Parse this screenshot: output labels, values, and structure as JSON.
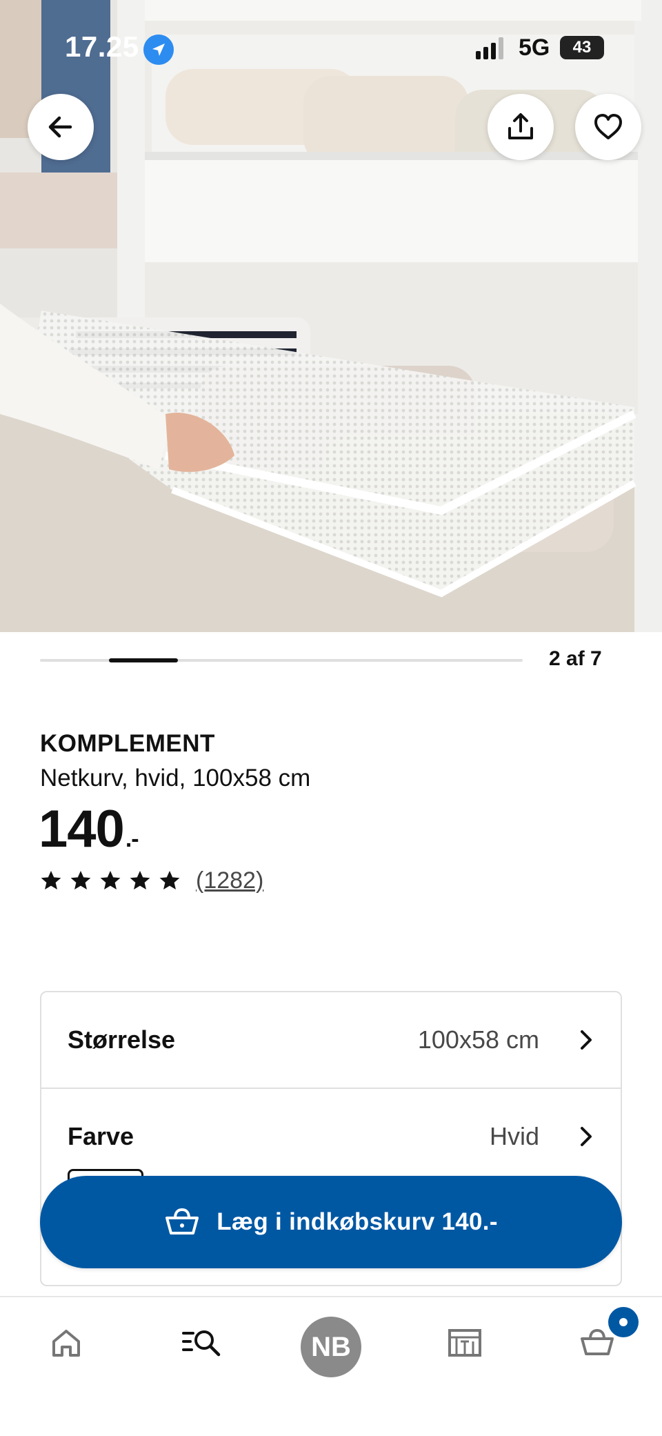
{
  "status_bar": {
    "time": "17.25",
    "network": "5G",
    "battery": "43"
  },
  "hero": {
    "icons": [
      "arrow-left-icon",
      "share-icon",
      "heart-icon"
    ]
  },
  "carousel": {
    "counter": "2 af 7",
    "current": 2,
    "total": 7
  },
  "product": {
    "name": "KOMPLEMENT",
    "description": "Netkurv, hvid, 100x58 cm",
    "price": "140",
    "price_suffix": ".-",
    "rating": 5,
    "review_count": "(1282)"
  },
  "options": {
    "size_label": "Størrelse",
    "size_value": "100x58 cm",
    "color_label": "Farve",
    "color_value": "Hvid"
  },
  "cart_button": {
    "label": "Læg i indkøbskurv 140.-"
  },
  "bottom_nav": {
    "profile_initials": "NB",
    "items": [
      "home-icon",
      "search-icon",
      "profile-avatar",
      "store-icon",
      "cart-icon"
    ]
  },
  "colors": {
    "brand_blue": "#0058a3",
    "text": "#111111",
    "muted": "#484848",
    "border": "#dfdfdf"
  }
}
